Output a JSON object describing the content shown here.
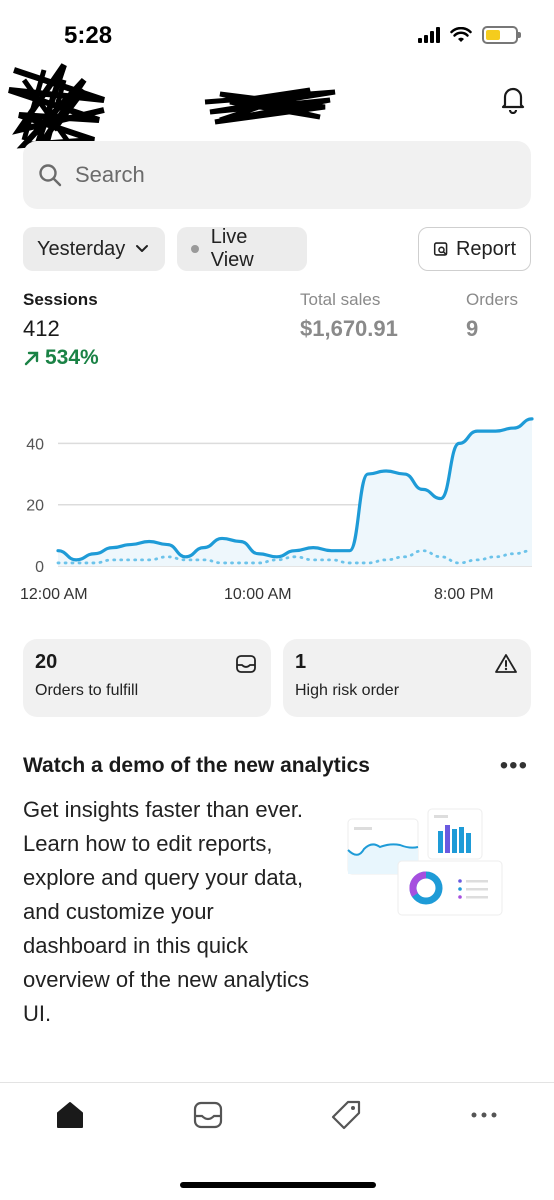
{
  "status_bar": {
    "time": "5:28"
  },
  "search": {
    "placeholder": "Search"
  },
  "filters": {
    "date_range": "Yesterday",
    "live_view": "Live View",
    "report": "Report"
  },
  "metrics": {
    "sessions": {
      "label": "Sessions",
      "value": "412",
      "change": "534%"
    },
    "total_sales": {
      "label": "Total sales",
      "value": "$1,670.91"
    },
    "orders": {
      "label": "Orders",
      "value": "9"
    }
  },
  "chart_data": {
    "type": "line",
    "y_ticks": [
      "0",
      "20",
      "40"
    ],
    "ylim": [
      0,
      50
    ],
    "x_ticks": [
      "12:00 AM",
      "10:00 AM",
      "8:00 PM"
    ],
    "grid": true,
    "series": [
      {
        "values": [
          5,
          2,
          4,
          6,
          7,
          8,
          7,
          3,
          6,
          9,
          8,
          4,
          3,
          5,
          6,
          5,
          5,
          30,
          31,
          30,
          25,
          22,
          40,
          44,
          44,
          45,
          48
        ],
        "style": "solid",
        "color": "#1e9bd7"
      },
      {
        "values": [
          1,
          1,
          1,
          2,
          2,
          2,
          3,
          2,
          2,
          1,
          1,
          1,
          2,
          3,
          2,
          2,
          1,
          1,
          2,
          3,
          5,
          3,
          1,
          2,
          3,
          4,
          5
        ],
        "style": "dotted",
        "color": "#6cc3ea"
      }
    ]
  },
  "cards": [
    {
      "count": "20",
      "label": "Orders to fulfill",
      "icon": "inbox-icon"
    },
    {
      "count": "1",
      "label": "High risk order",
      "icon": "warning-icon"
    }
  ],
  "demo": {
    "title": "Watch a demo of the new analytics",
    "body": "Get insights faster than ever. Learn how to edit reports, explore and query your data, and customize your dashboard in this quick overview of the new analytics UI."
  },
  "nav": [
    "home-icon",
    "orders-icon",
    "products-icon",
    "more-icon"
  ],
  "colors": {
    "accent": "#1e9bd7",
    "positive": "#1a8245"
  }
}
